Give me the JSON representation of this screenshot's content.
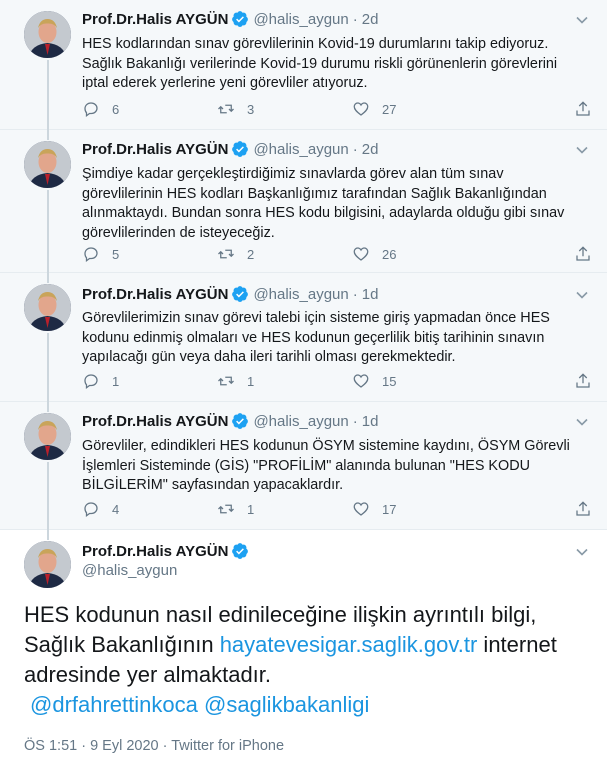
{
  "colors": {
    "accent": "#1b95e0",
    "muted": "#657786",
    "text": "#14171a",
    "thread_bg": "#f5f8fa"
  },
  "icons": [
    "verified-badge-icon",
    "chevron-down-icon",
    "reply-icon",
    "retweet-icon",
    "like-icon",
    "share-icon"
  ],
  "thread": [
    {
      "name": "Prof.Dr.Halis AYGÜN",
      "handle": "@halis_aygun",
      "sep": "·",
      "time": "2d",
      "lines": [
        "HES kodlarından sınav görevlilerinin Kovid-19 durumlarını takip ediyoruz.",
        "Sağlık Bakanlığı verilerinde Kovid-19 durumu riskli görünenlerin görevlerini",
        "iptal ederek yerlerine yeni görevliler atıyoruz."
      ],
      "replies": "6",
      "retweets": "3",
      "likes": "27"
    },
    {
      "name": "Prof.Dr.Halis AYGÜN",
      "handle": "@halis_aygun",
      "sep": "·",
      "time": "2d",
      "lines": [
        "Şimdiye kadar gerçekleştirdiğimiz sınavlarda görev alan tüm sınav",
        "görevlilerinin HES kodları Başkanlığımız tarafından Sağlık Bakanlığından",
        "alınmaktaydı. Bundan sonra HES kodu bilgisini, adaylarda olduğu gibi sınav",
        "görevlilerinden de isteyeceğiz."
      ],
      "replies": "5",
      "retweets": "2",
      "likes": "26"
    },
    {
      "name": "Prof.Dr.Halis AYGÜN",
      "handle": "@halis_aygun",
      "sep": "·",
      "time": "1d",
      "lines": [
        "Görevlilerimizin sınav görevi talebi için sisteme giriş yapmadan önce HES",
        "kodunu edinmiş olmaları ve HES kodunun geçerlilik bitiş tarihinin sınavın",
        "yapılacağı gün veya daha ileri tarihli olması gerekmektedir."
      ],
      "replies": "1",
      "retweets": "1",
      "likes": "15"
    },
    {
      "name": "Prof.Dr.Halis AYGÜN",
      "handle": "@halis_aygun",
      "sep": "·",
      "time": "1d",
      "lines": [
        "Görevliler, edindikleri HES kodunun ÖSYM sistemine kaydını, ÖSYM Görevli",
        "İşlemleri Sisteminde (GİS) \"PROFİLİM\" alanında bulunan \"HES KODU",
        "BİLGİLERİM\" sayfasından yapacaklardır."
      ],
      "replies": "4",
      "retweets": "1",
      "likes": "17"
    }
  ],
  "main": {
    "name": "Prof.Dr.Halis AYGÜN",
    "handle": "@halis_aygun",
    "text_1": "HES kodunun nasıl edinileceğine ilişkin ayrıntılı bilgi,",
    "text_2_before": "Sağlık Bakanlığının ",
    "link": "hayatevesigar.saglik.gov.tr",
    "text_2_after": " internet",
    "text_3": "adresinde yer almaktadır.",
    "mention_1": "@drfahrettinkoca",
    "mention_2": "@saglikbakanligi",
    "meta": "ÖS 1:51 · 9 Eyl 2020 · Twitter for iPhone"
  }
}
